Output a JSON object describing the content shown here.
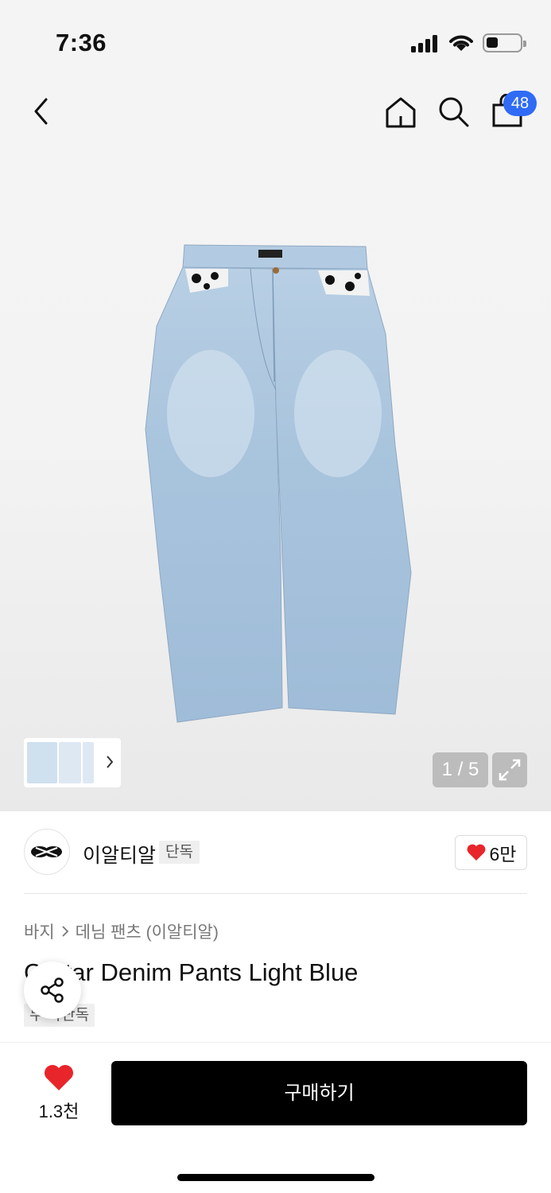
{
  "status_bar": {
    "time": "7:36"
  },
  "header": {
    "cart_count": "48",
    "icons": [
      "back-icon",
      "home-icon",
      "search-icon",
      "bag-icon"
    ]
  },
  "gallery": {
    "counter": "1 / 5",
    "thumbnail_count": 3
  },
  "brand": {
    "name": "이알티알",
    "exclusive_label": "단독",
    "likes": "6만"
  },
  "product": {
    "breadcrumb": [
      "바지",
      "데님 팬츠 (이알티알)"
    ],
    "title": "C    Star Denim Pants Light Blue",
    "badge": "무   사단독"
  },
  "bottom": {
    "favorite_count": "1.3천",
    "buy_label": "구매하기"
  },
  "colors": {
    "accent_blue": "#2f6bf5",
    "heart_red": "#e8252b",
    "denim": "#aac6df"
  }
}
